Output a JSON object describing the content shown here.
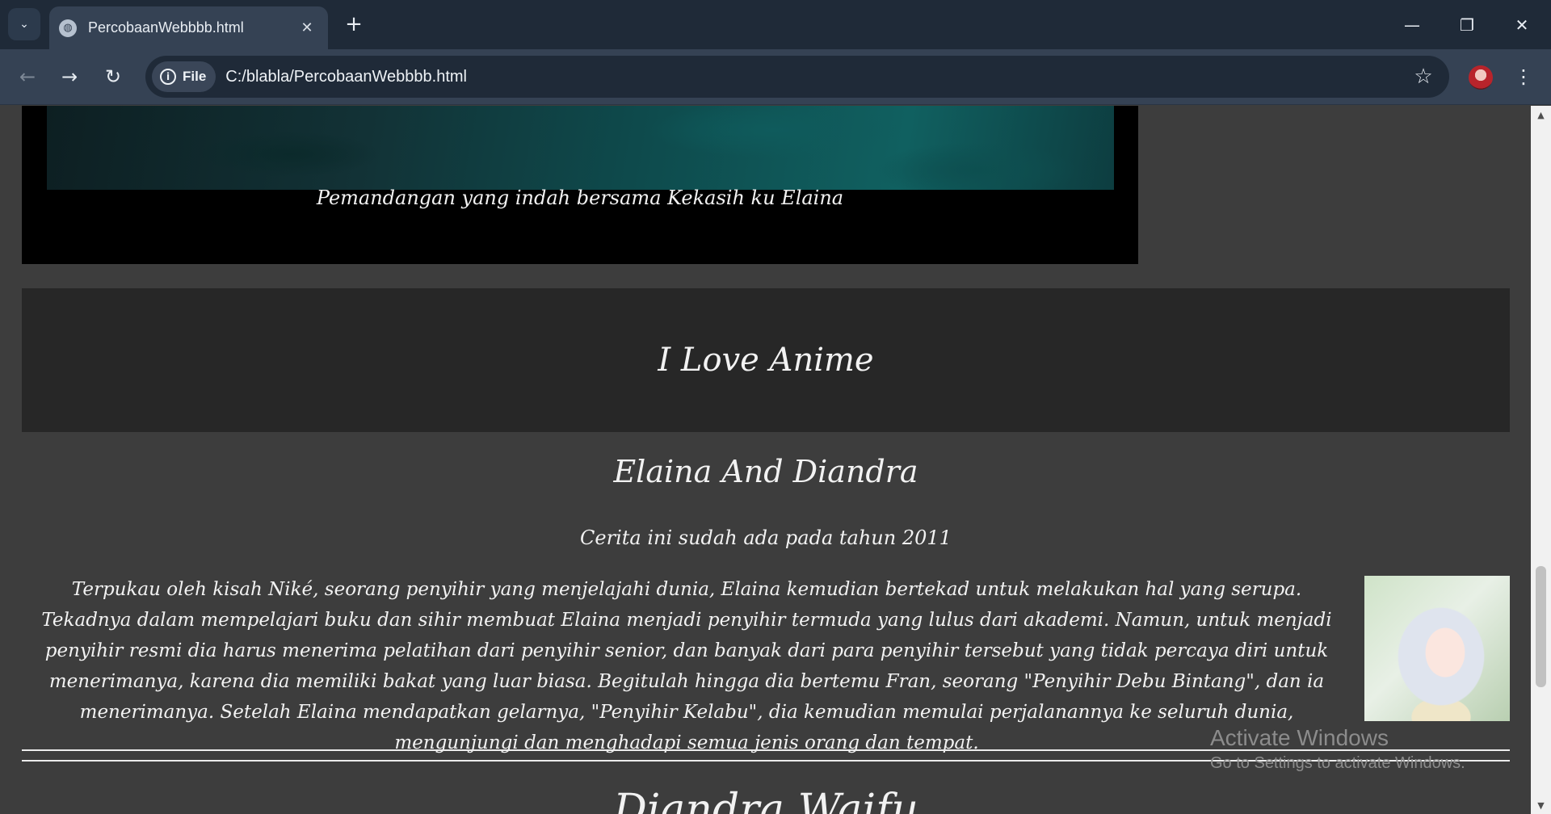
{
  "browser": {
    "tab_title": "PercobaanWebbbb.html",
    "tab_close": "✕",
    "new_tab": "+",
    "site_chip": "File",
    "url": "C:/blabla/PercobaanWebbbb.html",
    "icons": {
      "tab_search": "chevron-down-icon",
      "favicon": "globe-icon",
      "back": "arrow-left-icon",
      "forward": "arrow-right-icon",
      "reload": "reload-icon",
      "info": "info-icon",
      "bookmark": "star-icon",
      "menu": "kebab-menu-icon"
    },
    "window_controls": {
      "minimize": "—",
      "restore": "❐",
      "close": "✕"
    }
  },
  "page": {
    "gallery_caption": "Pemandangan yang indah bersama Kekasih ku Elaina",
    "header_title": "I Love Anime",
    "section_title": "Elaina And Diandra",
    "section_subtitle": "Cerita ini sudah ada pada tahun 2011",
    "story": "Terpukau oleh kisah Niké, seorang penyihir yang menjelajahi dunia, Elaina kemudian bertekad untuk melakukan hal yang serupa. Tekadnya dalam mempelajari buku dan sihir membuat Elaina menjadi penyihir termuda yang lulus dari akademi. Namun, untuk menjadi penyihir resmi dia harus menerima pelatihan dari penyihir senior, dan banyak dari para penyihir tersebut yang tidak percaya diri untuk menerimanya, karena dia memiliki bakat yang luar biasa. Begitulah hingga dia bertemu Fran, seorang \"Penyihir Debu Bintang\", dan ia menerimanya. Setelah Elaina mendapatkan gelarnya, \"Penyihir Kelabu\", dia kemudian memulai perjalanannya ke seluruh dunia, mengunjungi dan menghadapi semua jenis orang dan tempat.",
    "next_section_title": "Diandra Waifu"
  },
  "watermark": {
    "line1": "Activate Windows",
    "line2": "Go to Settings to activate Windows."
  },
  "colors": {
    "page_bg": "#3d3d3d",
    "header_bg": "#272727",
    "gallery_bg": "#000000",
    "chrome_dark": "#1f2a38",
    "chrome_mid": "#354254"
  }
}
